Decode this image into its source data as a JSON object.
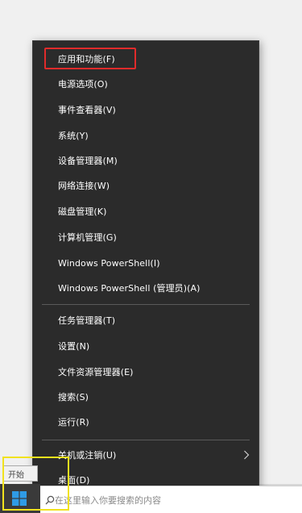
{
  "menu": {
    "items": [
      {
        "label": "应用和功能(F)"
      },
      {
        "label": "电源选项(O)"
      },
      {
        "label": "事件查看器(V)"
      },
      {
        "label": "系统(Y)"
      },
      {
        "label": "设备管理器(M)"
      },
      {
        "label": "网络连接(W)"
      },
      {
        "label": "磁盘管理(K)"
      },
      {
        "label": "计算机管理(G)"
      },
      {
        "label": "Windows PowerShell(I)"
      },
      {
        "label": "Windows PowerShell (管理员)(A)"
      },
      {
        "label": "任务管理器(T)"
      },
      {
        "label": "设置(N)"
      },
      {
        "label": "文件资源管理器(E)"
      },
      {
        "label": "搜索(S)"
      },
      {
        "label": "运行(R)"
      },
      {
        "label": "关机或注销(U)"
      },
      {
        "label": "桌面(D)"
      }
    ]
  },
  "taskbar": {
    "start_tooltip": "开始",
    "search_placeholder": "在这里输入你要搜索的内容"
  },
  "colors": {
    "menu_bg": "#2b2b2b",
    "highlight": "#e02b2b",
    "annotation": "#f1e21e"
  },
  "icons": [
    "windows-logo-icon",
    "search-icon",
    "chevron-right-icon"
  ]
}
